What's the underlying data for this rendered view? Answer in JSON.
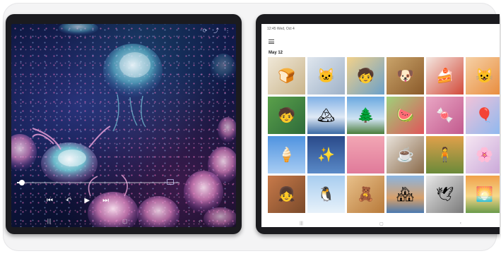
{
  "player": {
    "progress_fraction": 0.03,
    "controls": {
      "prev_label": "⏮",
      "rewind_label": "↶",
      "play_label": "▶",
      "next_label": "⏭"
    },
    "top_icons": [
      "screen-rotate-icon",
      "share-icon",
      "more-icon"
    ]
  },
  "gallery": {
    "status_text": "12:45  Wed, Oct 4",
    "section_date": "May 12",
    "photos": [
      {
        "name": "photo-bread-dog",
        "bg": "linear-gradient(135deg,#f0e8d8,#c9b48a)",
        "glyph": "🍞"
      },
      {
        "name": "photo-cat",
        "bg": "linear-gradient(135deg,#dfe6ee,#9fb2c8)",
        "glyph": "🐱"
      },
      {
        "name": "photo-child-toy",
        "bg": "linear-gradient(135deg,#f2d18a,#6aa0c9)",
        "glyph": "🧒"
      },
      {
        "name": "photo-dog-crown",
        "bg": "linear-gradient(135deg,#c9a36a,#8a5a2a)",
        "glyph": "🐶"
      },
      {
        "name": "photo-dessert",
        "bg": "linear-gradient(135deg,#f4e7e0,#d24a3a)",
        "glyph": "🍰"
      },
      {
        "name": "photo-cat-drawing",
        "bg": "linear-gradient(135deg,#f6d1a6,#e88a3a)",
        "glyph": "😺"
      },
      {
        "name": "photo-child-green",
        "bg": "linear-gradient(135deg,#5aa04a,#2e6b3a)",
        "glyph": "🧒"
      },
      {
        "name": "photo-mountain-lake",
        "bg": "linear-gradient(180deg,#7fb0e6,#dfe9f5 55%,#3a6aa4)",
        "glyph": "🏔"
      },
      {
        "name": "photo-tree-sky",
        "bg": "linear-gradient(180deg,#6aa8e0,#cfe3f2 60%,#4b7c3a)",
        "glyph": "🌲"
      },
      {
        "name": "photo-watermelon-girl",
        "bg": "linear-gradient(135deg,#9fd07a,#e0555a)",
        "glyph": "🍉"
      },
      {
        "name": "photo-macarons",
        "bg": "linear-gradient(135deg,#e9a6c4,#c25a8e)",
        "glyph": "🍬"
      },
      {
        "name": "photo-balloons",
        "bg": "linear-gradient(135deg,#f2c2d8,#8ab8f0)",
        "glyph": "🎈"
      },
      {
        "name": "photo-ice-cream",
        "bg": "linear-gradient(180deg,#4f93e0,#a9cdf3)",
        "glyph": "🍦"
      },
      {
        "name": "photo-night-sky",
        "bg": "linear-gradient(180deg,#2a4a8a,#5a8ac8)",
        "glyph": "✨"
      },
      {
        "name": "photo-pink-sky",
        "bg": "linear-gradient(180deg,#f2a6b4,#e07a9a)",
        "glyph": ""
      },
      {
        "name": "photo-coffee",
        "bg": "linear-gradient(135deg,#e8e2da,#8a6a4a)",
        "glyph": "☕"
      },
      {
        "name": "photo-autumn-path",
        "bg": "linear-gradient(180deg,#e0a04a,#6a8a3a)",
        "glyph": "🧍"
      },
      {
        "name": "photo-paper-rose",
        "bg": "linear-gradient(135deg,#f6e6f2,#c8a6d8)",
        "glyph": "🌸"
      },
      {
        "name": "photo-kids-smiling",
        "bg": "linear-gradient(135deg,#c87a4a,#7a4a2a)",
        "glyph": "👧"
      },
      {
        "name": "photo-snow-penguin",
        "bg": "linear-gradient(180deg,#a8cdf0,#e8f2fa)",
        "glyph": "🐧"
      },
      {
        "name": "photo-teddy-bear",
        "bg": "linear-gradient(135deg,#e8c08a,#b87a3a)",
        "glyph": "🧸"
      },
      {
        "name": "photo-coastal-town",
        "bg": "linear-gradient(180deg,#8ab4e0,#d8a06a 60%,#4a7ab0)",
        "glyph": "🏘"
      },
      {
        "name": "photo-bw-bird",
        "bg": "linear-gradient(135deg,#e8e8e8,#7a7a7a)",
        "glyph": "🕊"
      },
      {
        "name": "photo-sunset-field",
        "bg": "linear-gradient(180deg,#f0a04a,#f6d88a 55%,#6a9a4a)",
        "glyph": "🌅"
      }
    ]
  }
}
